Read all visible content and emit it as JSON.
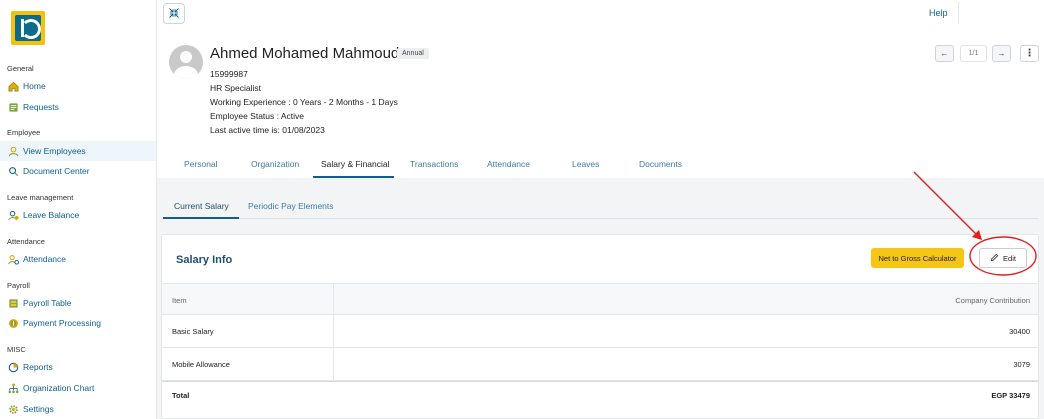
{
  "sidebar": {
    "sections": [
      {
        "label": "General",
        "items": [
          {
            "label": "Home",
            "icon": "home-icon"
          },
          {
            "label": "Requests",
            "icon": "requests-icon"
          }
        ]
      },
      {
        "label": "Employee",
        "items": [
          {
            "label": "View Employees",
            "icon": "user-icon",
            "active": true
          },
          {
            "label": "Document Center",
            "icon": "document-center-icon"
          }
        ]
      },
      {
        "label": "Leave management",
        "items": [
          {
            "label": "Leave Balance",
            "icon": "leave-balance-icon"
          }
        ]
      },
      {
        "label": "Attendance",
        "items": [
          {
            "label": "Attendance",
            "icon": "attendance-icon"
          }
        ]
      },
      {
        "label": "Payroll",
        "items": [
          {
            "label": "Payroll Table",
            "icon": "payroll-table-icon"
          },
          {
            "label": "Payment Processing",
            "icon": "payment-processing-icon"
          }
        ]
      },
      {
        "label": "MISC",
        "items": [
          {
            "label": "Reports",
            "icon": "reports-icon"
          },
          {
            "label": "Organization Chart",
            "icon": "org-chart-icon"
          },
          {
            "label": "Settings",
            "icon": "gear-icon"
          }
        ]
      }
    ]
  },
  "topbar": {
    "help": "Help"
  },
  "employee": {
    "name": "Ahmed Mohamed Mahmoud",
    "badge": "Annual",
    "id": "15999987",
    "title": "HR Specialist",
    "experience": "Working Experience : 0 Years - 2 Months - 1 Days",
    "status": "Employee Status : Active",
    "last_active": "Last active time is: 01/08/2023"
  },
  "pager": {
    "count": "1/1"
  },
  "tabs": [
    "Personal",
    "Organization",
    "Salary & Financial",
    "Transactions",
    "Attendance",
    "Leaves",
    "Documents"
  ],
  "active_tab": "Salary & Financial",
  "subtabs": [
    "Current Salary",
    "Periodic Pay Elements"
  ],
  "salary": {
    "title": "Salary Info",
    "calc_button": "Net to Gross Calculator",
    "edit_button": "Edit",
    "columns": [
      "Item",
      "Company Contribution"
    ],
    "rows": [
      {
        "item": "Basic Salary",
        "value": "30400"
      },
      {
        "item": "Mobile Allowance",
        "value": "3079"
      }
    ],
    "total_label": "Total",
    "total_value": "EGP 33479"
  },
  "colors": {
    "accent": "#0e5f8f",
    "calc_button": "#f5c518",
    "annotation": "#e0201e"
  }
}
